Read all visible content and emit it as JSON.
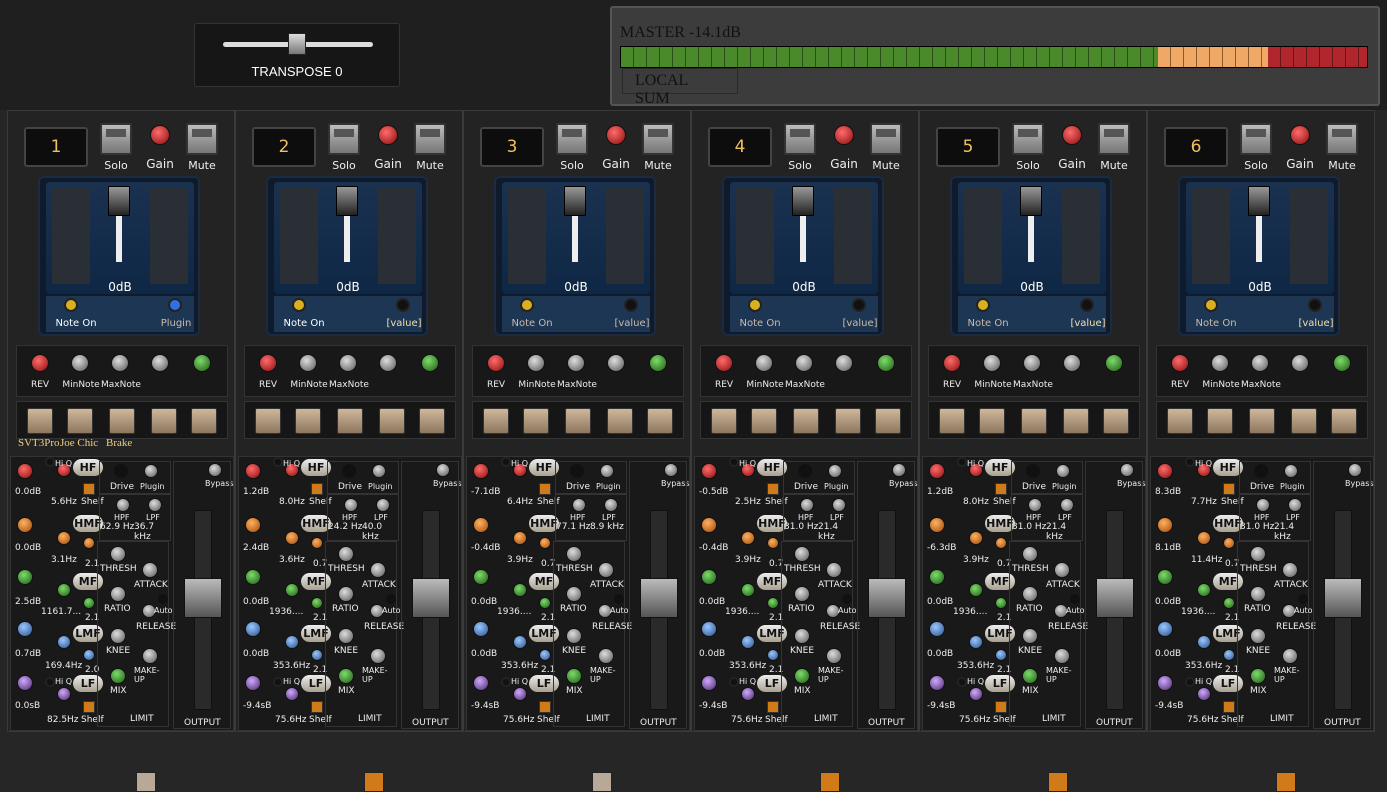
{
  "transpose": {
    "label": "TRANSPOSE 0"
  },
  "master": {
    "label": "MASTER -14.1dB",
    "local_sum": "LOCAL SUM"
  },
  "common": {
    "solo": "Solo",
    "gain": "Gain",
    "mute": "Mute",
    "db": "0dB",
    "rev": "REV",
    "minnote": "MinNote",
    "maxnote": "MaxNote",
    "hiq": "Hi Q",
    "hf": "HF",
    "hmf": "HMF",
    "mf": "MF",
    "lmf": "LMF",
    "lf": "LF",
    "shelf": "Shelf",
    "drive": "Drive",
    "plugin": "Plugin",
    "bypass": "Bypass",
    "hpf": "HPF",
    "lpf": "LPF",
    "thresh": "THRESH",
    "attack": "ATTACK",
    "ratio": "RATIO",
    "auto": "Auto",
    "release": "RELEASE",
    "knee": "KNEE",
    "makeup": "MAKE-UP",
    "mix": "MIX",
    "limit": "LIMIT",
    "output": "OUTPUT"
  },
  "channels": [
    {
      "num": "1",
      "note_on": "Note On",
      "right_label": "Plugin",
      "presets": [
        "SVT3Pro",
        "Joe Chic",
        "Brake"
      ],
      "hf_db": "0.0dB",
      "hf_freq": "5.6Hz",
      "hmf_db": "0.0dB",
      "hmf_freq": "3.1Hz",
      "hmf_q": "2.1",
      "mf_db": "2.5dB",
      "mf_freq": "1161.7...",
      "mf_q": "2.1",
      "lmf_db": "0.7dB",
      "lmf_freq": "169.4Hz",
      "lmf_q": "2.0",
      "lf_db": "0.0sB",
      "lf_freq": "82.5Hz",
      "hpf": "62.9 Hz",
      "lpf": "36.7 kHz",
      "limit_color": "#b8a898"
    },
    {
      "num": "2",
      "note_on": "Note On",
      "right_label": "[value]",
      "presets": [],
      "hf_db": "1.2dB",
      "hf_freq": "8.0Hz",
      "hmf_db": "2.4dB",
      "hmf_freq": "3.6Hz",
      "hmf_q": "0.7",
      "mf_db": "0.0dB",
      "mf_freq": "1936....",
      "mf_q": "2.1",
      "lmf_db": "0.0dB",
      "lmf_freq": "353.6Hz",
      "lmf_q": "2.1",
      "lf_db": "-9.4sB",
      "lf_freq": "75.6Hz",
      "hpf": "24.2 Hz",
      "lpf": "40.0 kHz",
      "limit_color": "#d07a1a"
    },
    {
      "num": "3",
      "note_on": "Note On",
      "right_label": "[value]",
      "presets": [],
      "hf_db": "-7.1dB",
      "hf_freq": "6.4Hz",
      "hmf_db": "-0.4dB",
      "hmf_freq": "3.9Hz",
      "hmf_q": "0.7",
      "mf_db": "0.0dB",
      "mf_freq": "1936....",
      "mf_q": "2.1",
      "lmf_db": "0.0dB",
      "lmf_freq": "353.6Hz",
      "lmf_q": "2.1",
      "lf_db": "-9.4sB",
      "lf_freq": "75.6Hz",
      "hpf": "77.1 Hz",
      "lpf": "8.9 kHz",
      "limit_color": "#b8a898"
    },
    {
      "num": "4",
      "note_on": "Note On",
      "right_label": "[value]",
      "presets": [],
      "hf_db": "-0.5dB",
      "hf_freq": "2.5Hz",
      "hmf_db": "-0.4dB",
      "hmf_freq": "3.9Hz",
      "hmf_q": "0.7",
      "mf_db": "0.0dB",
      "mf_freq": "1936....",
      "mf_q": "2.1",
      "lmf_db": "0.0dB",
      "lmf_freq": "353.6Hz",
      "lmf_q": "2.1",
      "lf_db": "-9.4sB",
      "lf_freq": "75.6Hz",
      "hpf": "31.0 Hz",
      "lpf": "21.4 kHz",
      "limit_color": "#d07a1a"
    },
    {
      "num": "5",
      "note_on": "Note On",
      "right_label": "[value]",
      "presets": [],
      "hf_db": "1.2dB",
      "hf_freq": "8.0Hz",
      "hmf_db": "-6.3dB",
      "hmf_freq": "3.9Hz",
      "hmf_q": "0.7",
      "mf_db": "0.0dB",
      "mf_freq": "1936....",
      "mf_q": "2.1",
      "lmf_db": "0.0dB",
      "lmf_freq": "353.6Hz",
      "lmf_q": "2.1",
      "lf_db": "-9.4sB",
      "lf_freq": "75.6Hz",
      "hpf": "31.0 Hz",
      "lpf": "21.4 kHz",
      "limit_color": "#d07a1a"
    },
    {
      "num": "6",
      "note_on": "Note On",
      "right_label": "[value]",
      "presets": [],
      "hf_db": "8.3dB",
      "hf_freq": "7.7Hz",
      "hmf_db": "8.1dB",
      "hmf_freq": "11.4Hz",
      "hmf_q": "0.7",
      "mf_db": "0.0dB",
      "mf_freq": "1936....",
      "mf_q": "2.1",
      "lmf_db": "0.0dB",
      "lmf_freq": "353.6Hz",
      "lmf_q": "2.1",
      "lf_db": "-9.4sB",
      "lf_freq": "75.6Hz",
      "hpf": "31.0 Hz",
      "lpf": "21.4 kHz",
      "limit_color": "#d07a1a"
    }
  ]
}
